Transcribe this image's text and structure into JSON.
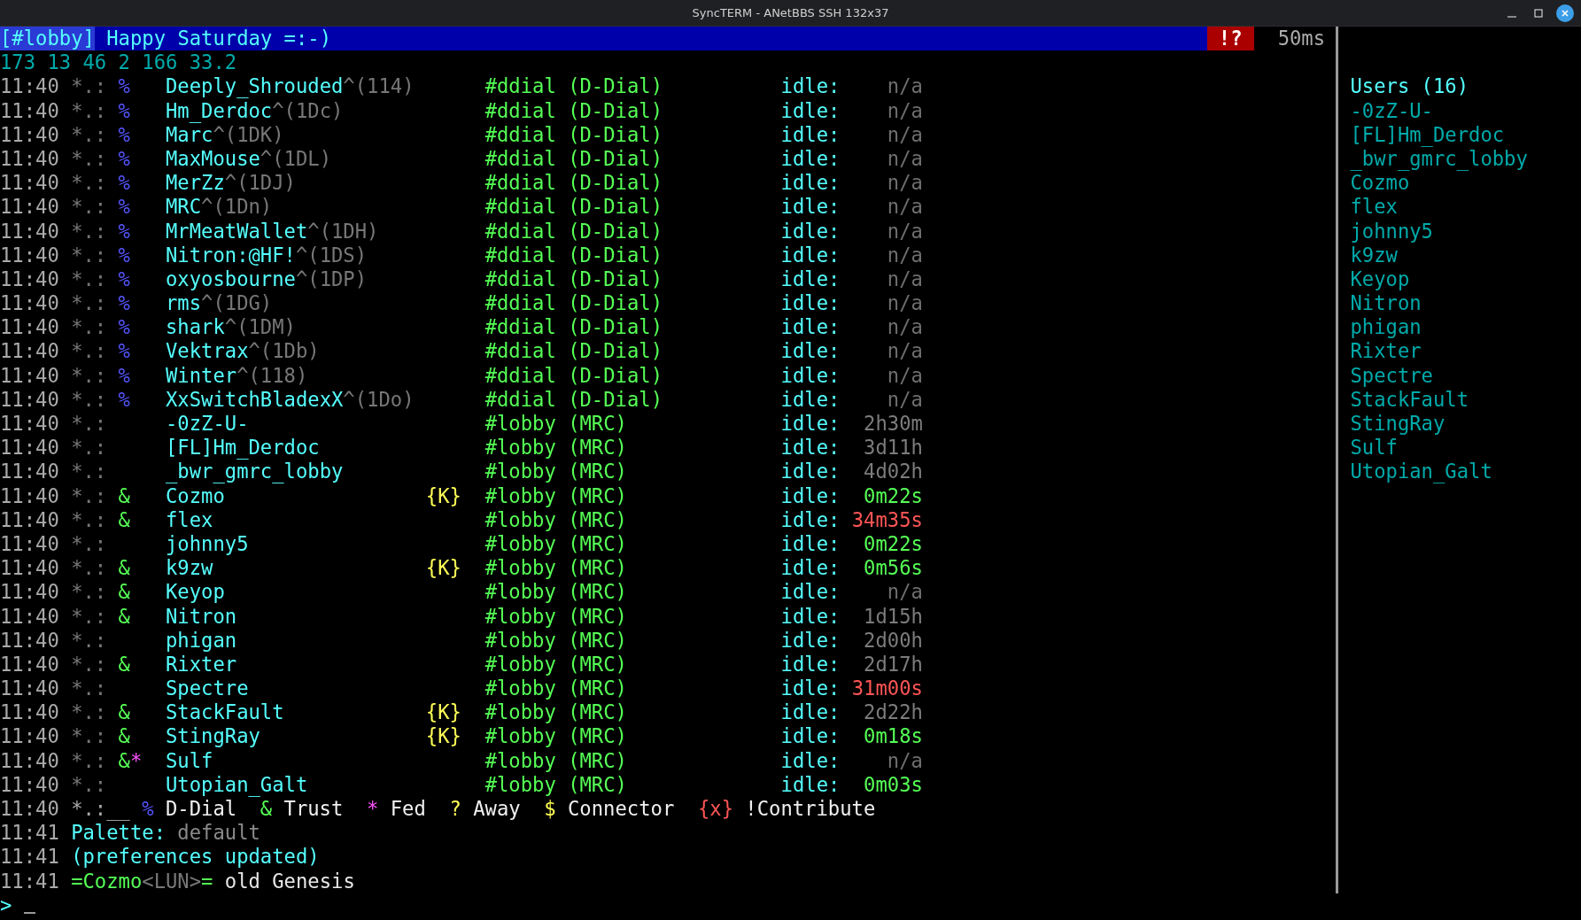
{
  "window": {
    "title": "SyncTERM - ANetBBS SSH 132x37"
  },
  "topic_bar": {
    "channel": "[#lobby]",
    "topic": "Happy Saturday =:-)",
    "alert": "!?",
    "latency": "50ms"
  },
  "stats": "173 13 46 2 166 33.2",
  "who_rows": [
    {
      "time": "11:40",
      "marker": "*.:",
      "flags": [
        {
          "text": "%",
          "kind": "ddial"
        }
      ],
      "nick": "Deeply_Shrouded",
      "suffix": "^(114)",
      "channel": "#ddial (D-Dial)",
      "idle_label": "idle:",
      "idle": "n/a",
      "color": "#6e6e6e"
    },
    {
      "time": "11:40",
      "marker": "*.:",
      "flags": [
        {
          "text": "%",
          "kind": "ddial"
        }
      ],
      "nick": "Hm_Derdoc",
      "suffix": "^(1Dc)",
      "channel": "#ddial (D-Dial)",
      "idle_label": "idle:",
      "idle": "n/a",
      "color": "#6e6e6e"
    },
    {
      "time": "11:40",
      "marker": "*.:",
      "flags": [
        {
          "text": "%",
          "kind": "ddial"
        }
      ],
      "nick": "Marc",
      "suffix": "^(1DK)",
      "channel": "#ddial (D-Dial)",
      "idle_label": "idle:",
      "idle": "n/a",
      "color": "#6e6e6e"
    },
    {
      "time": "11:40",
      "marker": "*.:",
      "flags": [
        {
          "text": "%",
          "kind": "ddial"
        }
      ],
      "nick": "MaxMouse",
      "suffix": "^(1DL)",
      "channel": "#ddial (D-Dial)",
      "idle_label": "idle:",
      "idle": "n/a",
      "color": "#6e6e6e"
    },
    {
      "time": "11:40",
      "marker": "*.:",
      "flags": [
        {
          "text": "%",
          "kind": "ddial"
        }
      ],
      "nick": "MerZz",
      "suffix": "^(1DJ)",
      "channel": "#ddial (D-Dial)",
      "idle_label": "idle:",
      "idle": "n/a",
      "color": "#6e6e6e"
    },
    {
      "time": "11:40",
      "marker": "*.:",
      "flags": [
        {
          "text": "%",
          "kind": "ddial"
        }
      ],
      "nick": "MRC",
      "suffix": "^(1Dn)",
      "channel": "#ddial (D-Dial)",
      "idle_label": "idle:",
      "idle": "n/a",
      "color": "#6e6e6e"
    },
    {
      "time": "11:40",
      "marker": "*.:",
      "flags": [
        {
          "text": "%",
          "kind": "ddial"
        }
      ],
      "nick": "MrMeatWallet",
      "suffix": "^(1DH)",
      "channel": "#ddial (D-Dial)",
      "idle_label": "idle:",
      "idle": "n/a",
      "color": "#6e6e6e"
    },
    {
      "time": "11:40",
      "marker": "*.:",
      "flags": [
        {
          "text": "%",
          "kind": "ddial"
        }
      ],
      "nick": "Nitron:@HF!",
      "suffix": "^(1DS)",
      "channel": "#ddial (D-Dial)",
      "idle_label": "idle:",
      "idle": "n/a",
      "color": "#6e6e6e"
    },
    {
      "time": "11:40",
      "marker": "*.:",
      "flags": [
        {
          "text": "%",
          "kind": "ddial"
        }
      ],
      "nick": "oxyosbourne",
      "suffix": "^(1DP)",
      "channel": "#ddial (D-Dial)",
      "idle_label": "idle:",
      "idle": "n/a",
      "color": "#6e6e6e"
    },
    {
      "time": "11:40",
      "marker": "*.:",
      "flags": [
        {
          "text": "%",
          "kind": "ddial"
        }
      ],
      "nick": "rms",
      "suffix": "^(1DG)",
      "channel": "#ddial (D-Dial)",
      "idle_label": "idle:",
      "idle": "n/a",
      "color": "#6e6e6e"
    },
    {
      "time": "11:40",
      "marker": "*.:",
      "flags": [
        {
          "text": "%",
          "kind": "ddial"
        }
      ],
      "nick": "shark",
      "suffix": "^(1DM)",
      "channel": "#ddial (D-Dial)",
      "idle_label": "idle:",
      "idle": "n/a",
      "color": "#6e6e6e"
    },
    {
      "time": "11:40",
      "marker": "*.:",
      "flags": [
        {
          "text": "%",
          "kind": "ddial"
        }
      ],
      "nick": "Vektrax",
      "suffix": "^(1Db)",
      "channel": "#ddial (D-Dial)",
      "idle_label": "idle:",
      "idle": "n/a",
      "color": "#6e6e6e"
    },
    {
      "time": "11:40",
      "marker": "*.:",
      "flags": [
        {
          "text": "%",
          "kind": "ddial"
        }
      ],
      "nick": "Winter",
      "suffix": "^(118)",
      "channel": "#ddial (D-Dial)",
      "idle_label": "idle:",
      "idle": "n/a",
      "color": "#6e6e6e"
    },
    {
      "time": "11:40",
      "marker": "*.:",
      "flags": [
        {
          "text": "%",
          "kind": "ddial"
        }
      ],
      "nick": "XxSwitchBladexX",
      "suffix": "^(1Do)",
      "channel": "#ddial (D-Dial)",
      "idle_label": "idle:",
      "idle": "n/a",
      "color": "#6e6e6e"
    },
    {
      "time": "11:40",
      "marker": "*.:",
      "flags": [],
      "nick": "-0zZ-U-",
      "channel": "#lobby (MRC)",
      "idle_label": "idle:",
      "idle": "2h30m",
      "color": "#7c7c7c"
    },
    {
      "time": "11:40",
      "marker": "*.:",
      "flags": [],
      "nick": "[FL]Hm_Derdoc",
      "channel": "#lobby (MRC)",
      "idle_label": "idle:",
      "idle": "3d11h",
      "color": "#7c7c7c"
    },
    {
      "time": "11:40",
      "marker": "*.:",
      "flags": [],
      "nick": "_bwr_gmrc_lobby",
      "channel": "#lobby (MRC)",
      "idle_label": "idle:",
      "idle": "4d02h",
      "color": "#7c7c7c"
    },
    {
      "time": "11:40",
      "marker": "*.:",
      "flags": [
        {
          "text": "&",
          "kind": "trust"
        }
      ],
      "nick": "Cozmo",
      "badge": "{K}",
      "channel": "#lobby (MRC)",
      "idle_label": "idle:",
      "idle": "0m22s",
      "color": "#55ff55"
    },
    {
      "time": "11:40",
      "marker": "*.:",
      "flags": [
        {
          "text": "&",
          "kind": "trust"
        }
      ],
      "nick": "flex",
      "channel": "#lobby (MRC)",
      "idle_label": "idle:",
      "idle": "34m35s",
      "color": "#ff5555"
    },
    {
      "time": "11:40",
      "marker": "*.:",
      "flags": [],
      "nick": "johnny5",
      "channel": "#lobby (MRC)",
      "idle_label": "idle:",
      "idle": "0m22s",
      "color": "#55ff55"
    },
    {
      "time": "11:40",
      "marker": "*.:",
      "flags": [
        {
          "text": "&",
          "kind": "trust"
        }
      ],
      "nick": "k9zw",
      "badge": "{K}",
      "channel": "#lobby (MRC)",
      "idle_label": "idle:",
      "idle": "0m56s",
      "color": "#55ff55"
    },
    {
      "time": "11:40",
      "marker": "*.:",
      "flags": [
        {
          "text": "&",
          "kind": "trust"
        }
      ],
      "nick": "Keyop",
      "channel": "#lobby (MRC)",
      "idle_label": "idle:",
      "idle": "n/a",
      "color": "#6e6e6e"
    },
    {
      "time": "11:40",
      "marker": "*.:",
      "flags": [
        {
          "text": "&",
          "kind": "trust"
        }
      ],
      "nick": "Nitron",
      "channel": "#lobby (MRC)",
      "idle_label": "idle:",
      "idle": "1d15h",
      "color": "#7c7c7c"
    },
    {
      "time": "11:40",
      "marker": "*.:",
      "flags": [],
      "nick": "phigan",
      "channel": "#lobby (MRC)",
      "idle_label": "idle:",
      "idle": "2d00h",
      "color": "#7c7c7c"
    },
    {
      "time": "11:40",
      "marker": "*.:",
      "flags": [
        {
          "text": "&",
          "kind": "trust"
        }
      ],
      "nick": "Rixter",
      "channel": "#lobby (MRC)",
      "idle_label": "idle:",
      "idle": "2d17h",
      "color": "#7c7c7c"
    },
    {
      "time": "11:40",
      "marker": "*.:",
      "flags": [],
      "nick": "Spectre",
      "channel": "#lobby (MRC)",
      "idle_label": "idle:",
      "idle": "31m00s",
      "color": "#ff5555"
    },
    {
      "time": "11:40",
      "marker": "*.:",
      "flags": [
        {
          "text": "&",
          "kind": "trust"
        }
      ],
      "nick": "StackFault",
      "badge": "{K}",
      "channel": "#lobby (MRC)",
      "idle_label": "idle:",
      "idle": "2d22h",
      "color": "#7c7c7c"
    },
    {
      "time": "11:40",
      "marker": "*.:",
      "flags": [
        {
          "text": "&",
          "kind": "trust"
        }
      ],
      "nick": "StingRay",
      "badge": "{K}",
      "channel": "#lobby (MRC)",
      "idle_label": "idle:",
      "idle": "0m18s",
      "color": "#55ff55"
    },
    {
      "time": "11:40",
      "marker": "*.:",
      "flags": [
        {
          "text": "&",
          "kind": "trust"
        },
        {
          "text": "*",
          "kind": "fed"
        }
      ],
      "nick": "Sulf",
      "channel": "#lobby (MRC)",
      "idle_label": "idle:",
      "idle": "n/a",
      "color": "#6e6e6e"
    },
    {
      "time": "11:40",
      "marker": "*.:",
      "flags": [],
      "nick": "Utopian_Galt",
      "channel": "#lobby (MRC)",
      "idle_label": "idle:",
      "idle": "0m03s",
      "color": "#55ff55"
    }
  ],
  "legend": {
    "time": "11:40",
    "marker": "*.:__",
    "items": [
      {
        "symbol": "%",
        "kind": "ddial",
        "label": "D-Dial"
      },
      {
        "symbol": "&",
        "kind": "trust",
        "label": "Trust"
      },
      {
        "symbol": "*",
        "kind": "fed",
        "label": "Fed"
      },
      {
        "symbol": "?",
        "kind": "away",
        "label": "Away"
      },
      {
        "symbol": "$",
        "kind": "connector",
        "label": "Connector"
      },
      {
        "symbol": "{x}",
        "kind": "contribute",
        "label": "!Contribute"
      }
    ]
  },
  "messages": [
    {
      "time": "11:41",
      "segments": [
        {
          "text": "Palette:",
          "kind": "label"
        },
        {
          "text": "default",
          "kind": "value"
        }
      ]
    },
    {
      "time": "11:41",
      "segments": [
        {
          "text": "(preferences updated)",
          "kind": "label"
        }
      ]
    },
    {
      "time": "11:41",
      "segments": [
        {
          "text": "=Cozmo",
          "kind": "nick"
        },
        {
          "text": "<LUN>",
          "kind": "tag"
        },
        {
          "text": "=",
          "kind": "nick"
        },
        {
          "text": "old Genesis",
          "kind": "text"
        }
      ]
    }
  ],
  "users": {
    "title": "Users (16)",
    "items": [
      "-0zZ-U-",
      "[FL]Hm_Derdoc",
      "_bwr_gmrc_lobby",
      "Cozmo",
      "flex",
      "johnny5",
      "k9zw",
      "Keyop",
      "Nitron",
      "phigan",
      "Rixter",
      "Spectre",
      "StackFault",
      "StingRay",
      "Sulf",
      "Utopian_Galt"
    ]
  },
  "prompt": ">"
}
